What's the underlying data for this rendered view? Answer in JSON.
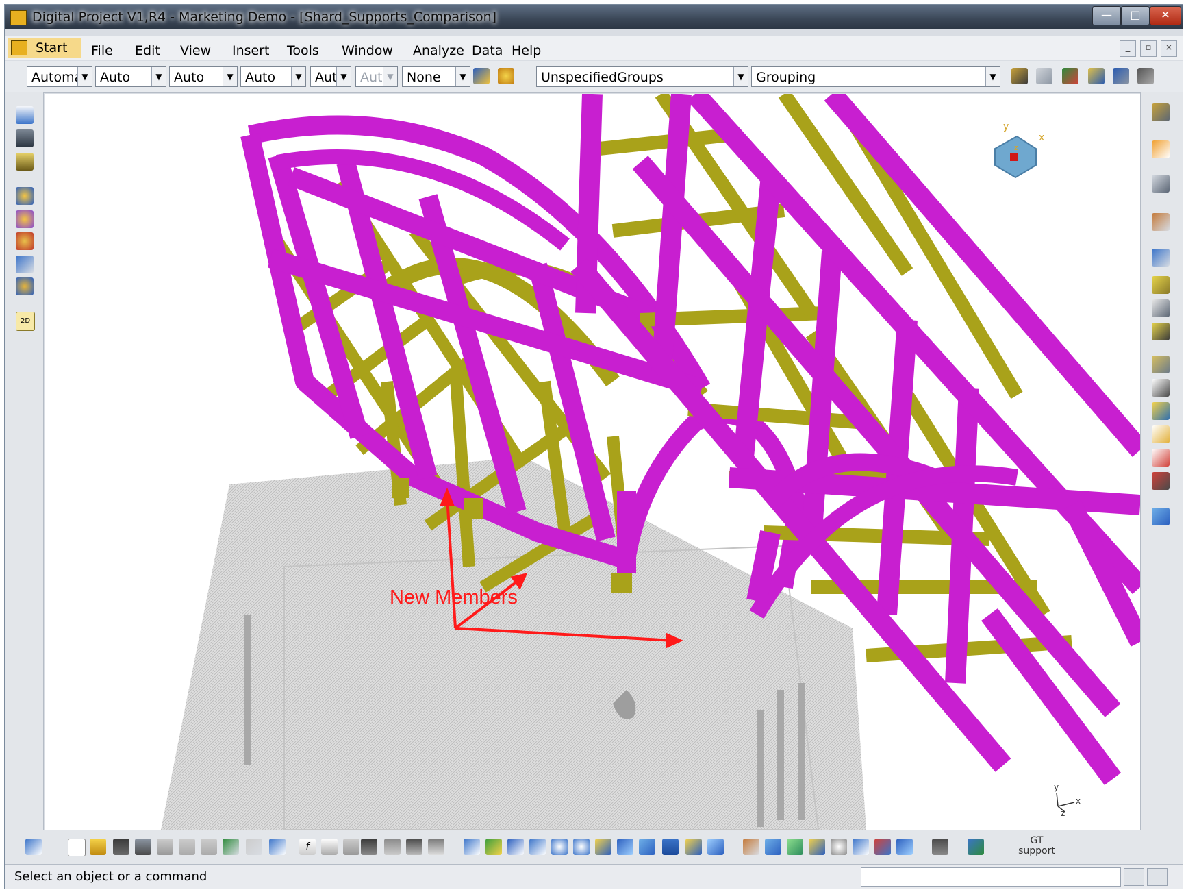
{
  "window": {
    "title": "Digital Project V1,R4  - Marketing Demo - [Shard_Supports_Comparison]",
    "caption_buttons": {
      "minimize": "—",
      "maximize": "□",
      "close": "✕"
    }
  },
  "menubar": {
    "start": "Start",
    "items": [
      "File",
      "Edit",
      "View",
      "Insert",
      "Tools",
      "Window",
      "Analyze",
      "Data",
      "Help"
    ],
    "mdi_buttons": [
      "_",
      "▫",
      "×"
    ]
  },
  "toolbar": {
    "combos": [
      {
        "value": "Automa",
        "enabled": true
      },
      {
        "value": "Auto",
        "enabled": true
      },
      {
        "value": "Auto",
        "enabled": true
      },
      {
        "value": "Auto",
        "enabled": true
      },
      {
        "value": "Aut",
        "enabled": true
      },
      {
        "value": "Aut",
        "enabled": false
      },
      {
        "value": "None",
        "enabled": true
      },
      {
        "value": "UnspecifiedGroups",
        "enabled": true
      },
      {
        "value": "Grouping",
        "enabled": true
      }
    ]
  },
  "viewport": {
    "annotation": "New Members",
    "annotation_color": "#ff1a1a",
    "member_colors": {
      "primary": "#c81fd0",
      "secondary": "#a9a21a"
    },
    "compass_labels": {
      "x": "x",
      "y": "y",
      "z": "z"
    },
    "axis_labels": {
      "x": "x",
      "y": "y",
      "z": "z"
    }
  },
  "bottom_toolbar": {
    "gt_support": "GT support"
  },
  "statusbar": {
    "message": "Select an object or a command"
  },
  "icons": {
    "left": [
      "measure-icon",
      "print-icon",
      "battery-icon",
      "assembly-icon",
      "tools-icon",
      "wheel-icon",
      "cube-move-icon",
      "knowledge-icon",
      "2d-icon"
    ],
    "right": [
      "catalog-icon",
      "select-icon",
      "select-trap-icon",
      "select-bracket-icon",
      "pipe-icon",
      "plate-icon",
      "column-icon",
      "beam-icon",
      "tree-icon",
      "document-icon",
      "export-icon",
      "import-icon",
      "report-icon",
      "link-icon",
      "eraser-icon"
    ]
  }
}
